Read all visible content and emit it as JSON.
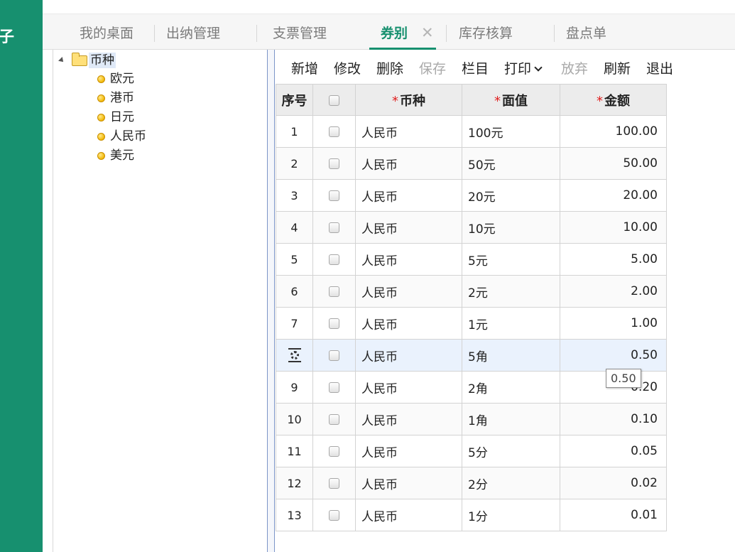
{
  "rail": {
    "glyph": "子"
  },
  "tabs": [
    {
      "label": "我的桌面"
    },
    {
      "label": "出纳管理"
    },
    {
      "label": "支票管理"
    },
    {
      "label": "券别",
      "active": true
    },
    {
      "label": "库存核算"
    },
    {
      "label": "盘点单"
    }
  ],
  "tab_close": "✕",
  "tree": {
    "root": "币种",
    "items": [
      {
        "label": "欧元"
      },
      {
        "label": "港币"
      },
      {
        "label": "日元"
      },
      {
        "label": "人民币"
      },
      {
        "label": "美元"
      }
    ]
  },
  "toolbar": [
    {
      "label": "新增",
      "enabled": true
    },
    {
      "label": "修改",
      "enabled": true
    },
    {
      "label": "删除",
      "enabled": true
    },
    {
      "label": "保存",
      "enabled": false
    },
    {
      "label": "栏目",
      "enabled": true
    },
    {
      "label": "打印",
      "enabled": true
    },
    {
      "label": "放弃",
      "enabled": false
    },
    {
      "label": "刷新",
      "enabled": true
    },
    {
      "label": "退出",
      "enabled": true
    }
  ],
  "grid": {
    "headers": {
      "index": "序号",
      "currency": "币种",
      "denomination": "面值",
      "amount": "金额"
    },
    "required_mark": "*",
    "rows": [
      {
        "index": "1",
        "currency": "人民币",
        "denomination": "100元",
        "amount": "100.00"
      },
      {
        "index": "2",
        "currency": "人民币",
        "denomination": "50元",
        "amount": "50.00"
      },
      {
        "index": "3",
        "currency": "人民币",
        "denomination": "20元",
        "amount": "20.00"
      },
      {
        "index": "4",
        "currency": "人民币",
        "denomination": "10元",
        "amount": "10.00"
      },
      {
        "index": "5",
        "currency": "人民币",
        "denomination": "5元",
        "amount": "5.00"
      },
      {
        "index": "6",
        "currency": "人民币",
        "denomination": "2元",
        "amount": "2.00"
      },
      {
        "index": "7",
        "currency": "人民币",
        "denomination": "1元",
        "amount": "1.00"
      },
      {
        "index": "",
        "currency": "人民币",
        "denomination": "5角",
        "amount": "0.50",
        "current": true
      },
      {
        "index": "9",
        "currency": "人民币",
        "denomination": "2角",
        "amount": "0.20"
      },
      {
        "index": "10",
        "currency": "人民币",
        "denomination": "1角",
        "amount": "0.10"
      },
      {
        "index": "11",
        "currency": "人民币",
        "denomination": "5分",
        "amount": "0.05"
      },
      {
        "index": "12",
        "currency": "人民币",
        "denomination": "2分",
        "amount": "0.02"
      },
      {
        "index": "13",
        "currency": "人民币",
        "denomination": "1分",
        "amount": "0.01"
      }
    ]
  },
  "tooltip": {
    "text": "0.50"
  },
  "colors": {
    "brand": "#17906f",
    "required": "#e02020",
    "selection": "#eaf2fd"
  }
}
